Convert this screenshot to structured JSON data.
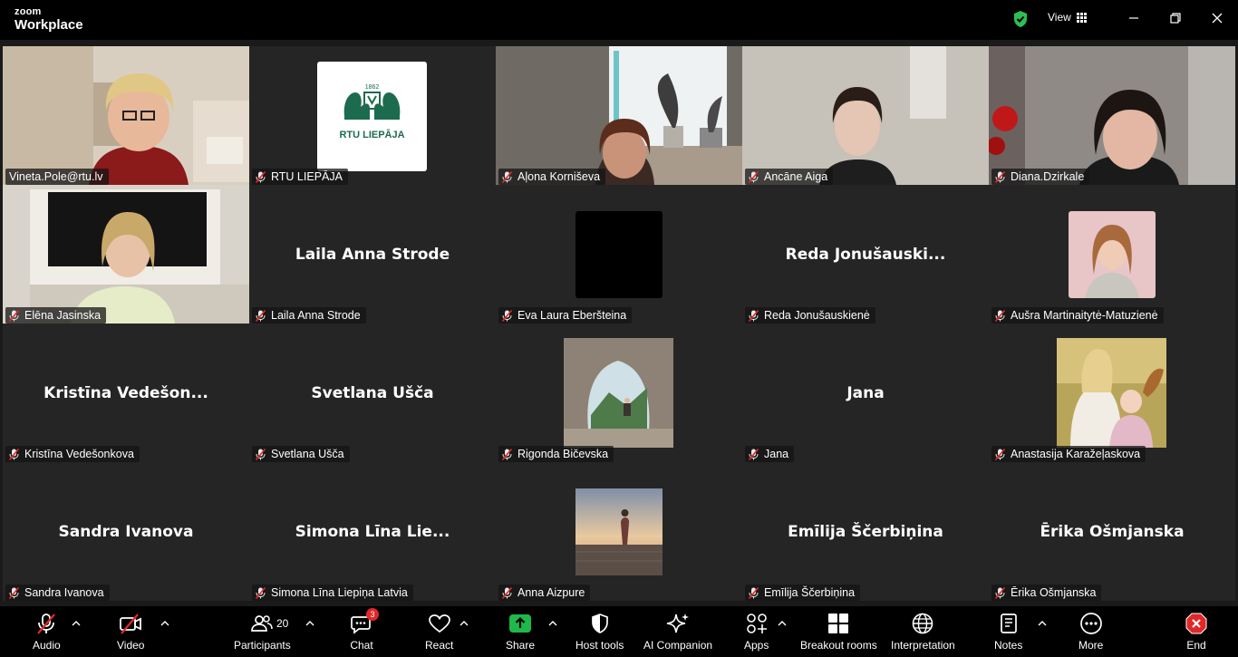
{
  "app": {
    "brand_top": "zoom",
    "brand_bottom": "Workplace",
    "view_label": "View"
  },
  "tiles": [
    {
      "name": "Vineta.Pole@rtu.lv",
      "center": "",
      "type": "video-woman-office"
    },
    {
      "name": "RTU LIEPĀJA",
      "center": "",
      "type": "logo"
    },
    {
      "name": "Aļona Korniševa",
      "center": "",
      "type": "video-window"
    },
    {
      "name": "Ancāne Aiga",
      "center": "",
      "type": "video-wall"
    },
    {
      "name": "Diana.Dzirkale",
      "center": "",
      "type": "video-dark"
    },
    {
      "name": "Elēna Jasinska",
      "center": "",
      "type": "video-tv"
    },
    {
      "name": "Laila Anna Strode",
      "center": "Laila Anna Strode",
      "type": "name"
    },
    {
      "name": "Eva Laura Eberšteina",
      "center": "",
      "type": "black-avatar"
    },
    {
      "name": "Reda Jonušauskienė",
      "center": "Reda  Jonušauski...",
      "type": "name"
    },
    {
      "name": "Aušra Martinaitytė-Matuzienė",
      "center": "",
      "type": "pink-avatar"
    },
    {
      "name": "Kristīna Vedešonkova",
      "center": "Kristīna  Vedešon...",
      "type": "name"
    },
    {
      "name": "Svetlana Ušča",
      "center": "Svetlana Ušča",
      "type": "name"
    },
    {
      "name": "Rigonda Bičevska",
      "center": "",
      "type": "cave-avatar"
    },
    {
      "name": "Jana",
      "center": "Jana",
      "type": "name"
    },
    {
      "name": "Anastasija Karažeļaskova",
      "center": "",
      "type": "family-avatar"
    },
    {
      "name": "Sandra Ivanova",
      "center": "Sandra Ivanova",
      "type": "name"
    },
    {
      "name": "Simona Līna Liepiņa Latvia",
      "center": "Simona  Līna  Lie...",
      "type": "name"
    },
    {
      "name": "Anna Aizpure",
      "center": "",
      "type": "sunset-avatar"
    },
    {
      "name": "Emīlija Ščerbiņina",
      "center": "Emīlija Ščerbiņina",
      "type": "name"
    },
    {
      "name": "Ērika Ošmjanska",
      "center": "Ērika Ošmjanska",
      "type": "name"
    }
  ],
  "logo_tile": {
    "year": "1862",
    "text": "RTU LIEPĀJA"
  },
  "toolbar": {
    "audio": "Audio",
    "video": "Video",
    "participants": "Participants",
    "participants_count": "20",
    "chat": "Chat",
    "chat_badge": "3",
    "react": "React",
    "share": "Share",
    "host_tools": "Host tools",
    "ai_companion": "AI Companion",
    "apps": "Apps",
    "breakout": "Breakout rooms",
    "interpretation": "Interpretation",
    "notes": "Notes",
    "more": "More",
    "end": "End"
  },
  "colors": {
    "active_border": "#23d959",
    "share": "#1fb84a",
    "end": "#e02828",
    "shield": "#2ebd52"
  }
}
